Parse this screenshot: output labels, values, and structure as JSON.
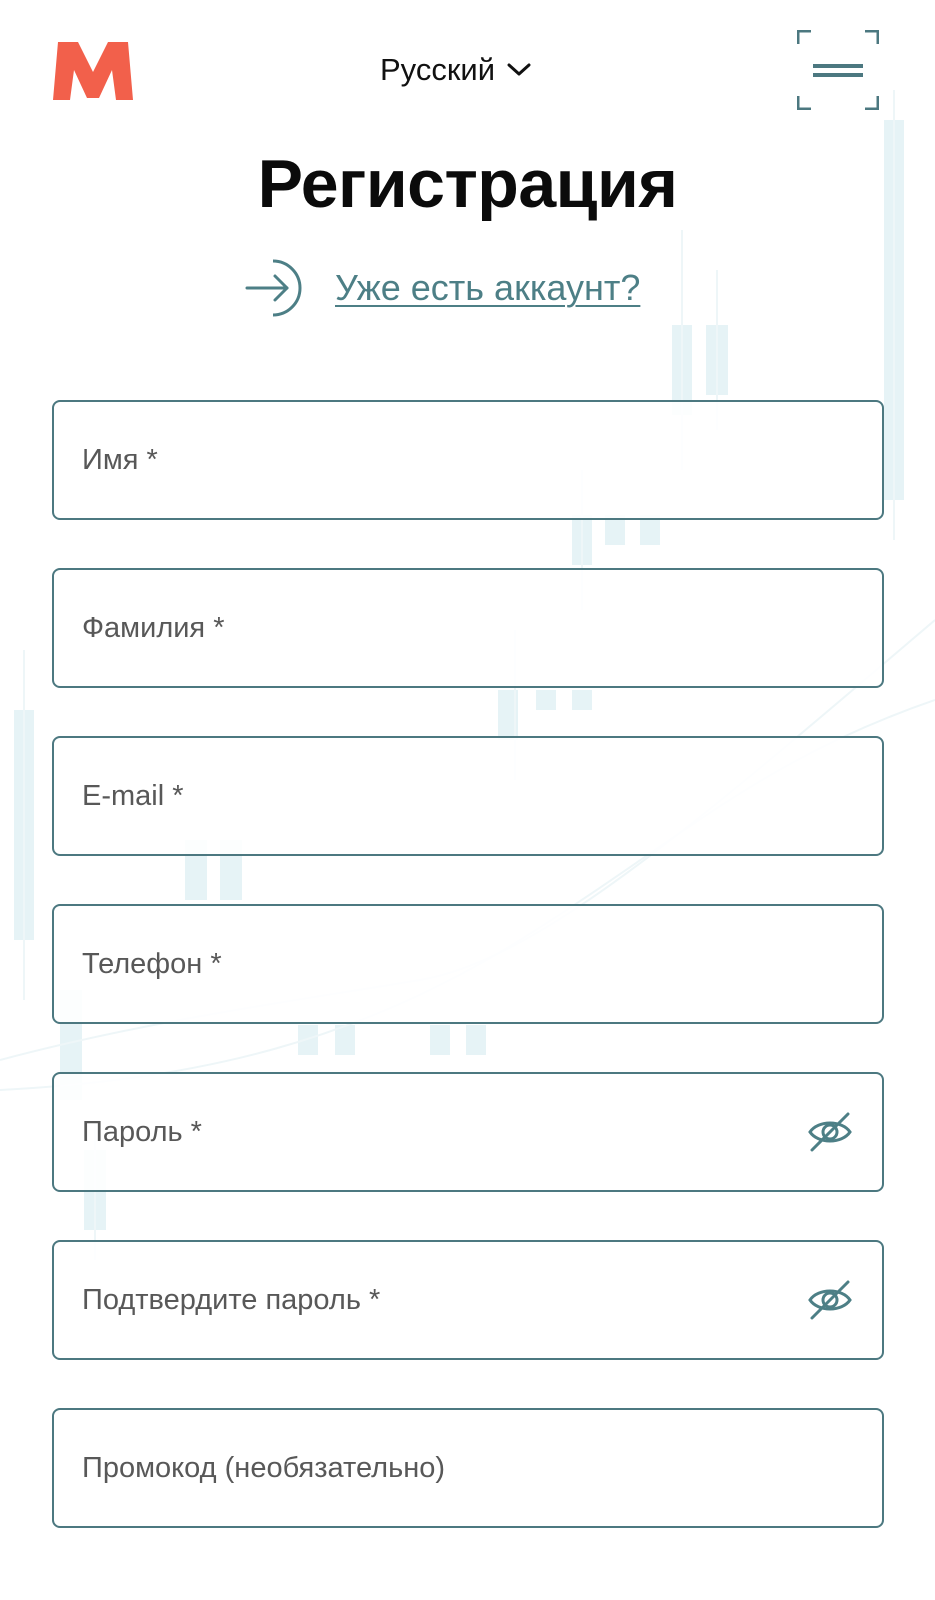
{
  "header": {
    "logo_icon": "brand-m-logo",
    "language": "Русский",
    "language_icon": "chevron-down-icon",
    "menu_icon": "hamburger-menu-icon"
  },
  "title": "Регистрация",
  "login_link": {
    "label": "Уже есть аккаунт?",
    "icon": "login-arrow-icon"
  },
  "form": {
    "first_name": {
      "placeholder": "Имя *"
    },
    "last_name": {
      "placeholder": "Фамилия *"
    },
    "email": {
      "placeholder": "E-mail *"
    },
    "phone": {
      "placeholder": "Телефон *"
    },
    "password": {
      "placeholder": "Пароль *",
      "toggle_icon": "eye-off-icon"
    },
    "confirm_password": {
      "placeholder": "Подтвердите пароль *",
      "toggle_icon": "eye-off-icon"
    },
    "promo": {
      "placeholder": "Промокод (необязательно)"
    }
  },
  "colors": {
    "brand": "#f2604b",
    "accent": "#4d7f86",
    "field_border": "#4c7880"
  }
}
